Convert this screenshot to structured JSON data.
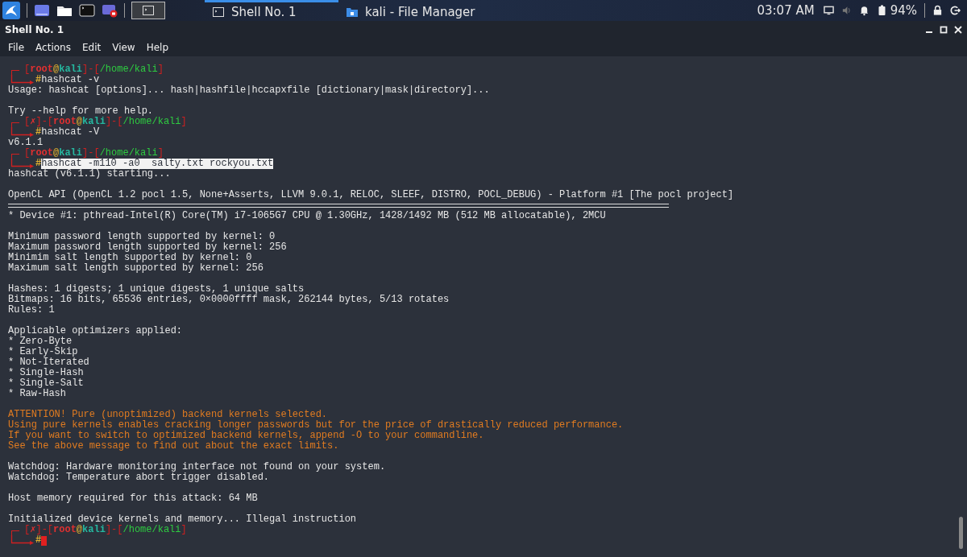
{
  "panel": {
    "tasks": [
      {
        "label": "Shell No. 1",
        "selected": true
      },
      {
        "label": "kali - File Manager",
        "selected": false
      }
    ],
    "clock": "03:07 AM",
    "battery": "94%"
  },
  "window": {
    "title": "Shell No. 1"
  },
  "menu": [
    "File",
    "Actions",
    "Edit",
    "View",
    "Help"
  ],
  "terminal": {
    "lines": [
      {
        "kind": "prompt",
        "segments": [
          {
            "t": "[",
            "kind": "frame"
          },
          {
            "t": "root",
            "kind": "user"
          },
          {
            "t": "@",
            "kind": "at"
          },
          {
            "t": "kali",
            "kind": "host"
          },
          {
            "t": "]-[",
            "kind": "frame"
          },
          {
            "t": "/home/kali",
            "kind": "path"
          },
          {
            "t": "]",
            "kind": "frame"
          }
        ]
      },
      {
        "kind": "input",
        "symbol": "#",
        "command": "hashcat -v",
        "selected": false
      },
      {
        "kind": "text",
        "text": "Usage: hashcat [options]... hash|hashfile|hccapxfile [dictionary|mask|directory]..."
      },
      {
        "kind": "blank"
      },
      {
        "kind": "text",
        "text": "Try --help for more help."
      },
      {
        "kind": "prompt",
        "segments": [
          {
            "t": "[",
            "kind": "frame"
          },
          {
            "t": "✗",
            "kind": "mark"
          },
          {
            "t": "]-[",
            "kind": "frame"
          },
          {
            "t": "root",
            "kind": "user"
          },
          {
            "t": "@",
            "kind": "at"
          },
          {
            "t": "kali",
            "kind": "host"
          },
          {
            "t": "]-[",
            "kind": "frame"
          },
          {
            "t": "/home/kali",
            "kind": "path"
          },
          {
            "t": "]",
            "kind": "frame"
          }
        ]
      },
      {
        "kind": "input",
        "symbol": "#",
        "command": "hashcat -V",
        "selected": false
      },
      {
        "kind": "text",
        "text": "v6.1.1"
      },
      {
        "kind": "prompt",
        "segments": [
          {
            "t": "[",
            "kind": "frame"
          },
          {
            "t": "root",
            "kind": "user"
          },
          {
            "t": "@",
            "kind": "at"
          },
          {
            "t": "kali",
            "kind": "host"
          },
          {
            "t": "]-[",
            "kind": "frame"
          },
          {
            "t": "/home/kali",
            "kind": "path"
          },
          {
            "t": "]",
            "kind": "frame"
          }
        ]
      },
      {
        "kind": "input",
        "symbol": "#",
        "command": "hashcat -m110 -a0  salty.txt rockyou.txt",
        "selected": true
      },
      {
        "kind": "text",
        "text": "hashcat (v6.1.1) starting..."
      },
      {
        "kind": "blank"
      },
      {
        "kind": "text",
        "text": "OpenCL API (OpenCL 1.2 pocl 1.5, None+Asserts, LLVM 9.0.1, RELOC, SLEEF, DISTRO, POCL_DEBUG) - Platform #1 [The pocl project]"
      },
      {
        "kind": "rule"
      },
      {
        "kind": "text",
        "text": "* Device #1: pthread-Intel(R) Core(TM) i7-1065G7 CPU @ 1.30GHz, 1428/1492 MB (512 MB allocatable), 2MCU"
      },
      {
        "kind": "blank"
      },
      {
        "kind": "text",
        "text": "Minimum password length supported by kernel: 0"
      },
      {
        "kind": "text",
        "text": "Maximum password length supported by kernel: 256"
      },
      {
        "kind": "text",
        "text": "Minimim salt length supported by kernel: 0"
      },
      {
        "kind": "text",
        "text": "Maximum salt length supported by kernel: 256"
      },
      {
        "kind": "blank"
      },
      {
        "kind": "text",
        "text": "Hashes: 1 digests; 1 unique digests, 1 unique salts"
      },
      {
        "kind": "text",
        "text": "Bitmaps: 16 bits, 65536 entries, 0×0000ffff mask, 262144 bytes, 5/13 rotates"
      },
      {
        "kind": "text",
        "text": "Rules: 1"
      },
      {
        "kind": "blank"
      },
      {
        "kind": "text",
        "text": "Applicable optimizers applied:"
      },
      {
        "kind": "text",
        "text": "* Zero-Byte"
      },
      {
        "kind": "text",
        "text": "* Early-Skip"
      },
      {
        "kind": "text",
        "text": "* Not-Iterated"
      },
      {
        "kind": "text",
        "text": "* Single-Hash"
      },
      {
        "kind": "text",
        "text": "* Single-Salt"
      },
      {
        "kind": "text",
        "text": "* Raw-Hash"
      },
      {
        "kind": "blank"
      },
      {
        "kind": "warning",
        "text": "ATTENTION! Pure (unoptimized) backend kernels selected."
      },
      {
        "kind": "warning",
        "text": "Using pure kernels enables cracking longer passwords but for the price of drastically reduced performance."
      },
      {
        "kind": "warning",
        "text": "If you want to switch to optimized backend kernels, append -O to your commandline."
      },
      {
        "kind": "warning",
        "text": "See the above message to find out about the exact limits."
      },
      {
        "kind": "blank"
      },
      {
        "kind": "text",
        "text": "Watchdog: Hardware monitoring interface not found on your system."
      },
      {
        "kind": "text",
        "text": "Watchdog: Temperature abort trigger disabled."
      },
      {
        "kind": "blank"
      },
      {
        "kind": "text",
        "text": "Host memory required for this attack: 64 MB"
      },
      {
        "kind": "blank"
      },
      {
        "kind": "text",
        "text": "Initialized device kernels and memory... Illegal instruction"
      },
      {
        "kind": "prompt",
        "segments": [
          {
            "t": "[",
            "kind": "frame"
          },
          {
            "t": "✗",
            "kind": "mark"
          },
          {
            "t": "]-[",
            "kind": "frame"
          },
          {
            "t": "root",
            "kind": "user"
          },
          {
            "t": "@",
            "kind": "at"
          },
          {
            "t": "kali",
            "kind": "host"
          },
          {
            "t": "]-[",
            "kind": "frame"
          },
          {
            "t": "/home/kali",
            "kind": "path"
          },
          {
            "t": "]",
            "kind": "frame"
          }
        ]
      },
      {
        "kind": "input",
        "symbol": "#",
        "cursor": true
      }
    ]
  }
}
